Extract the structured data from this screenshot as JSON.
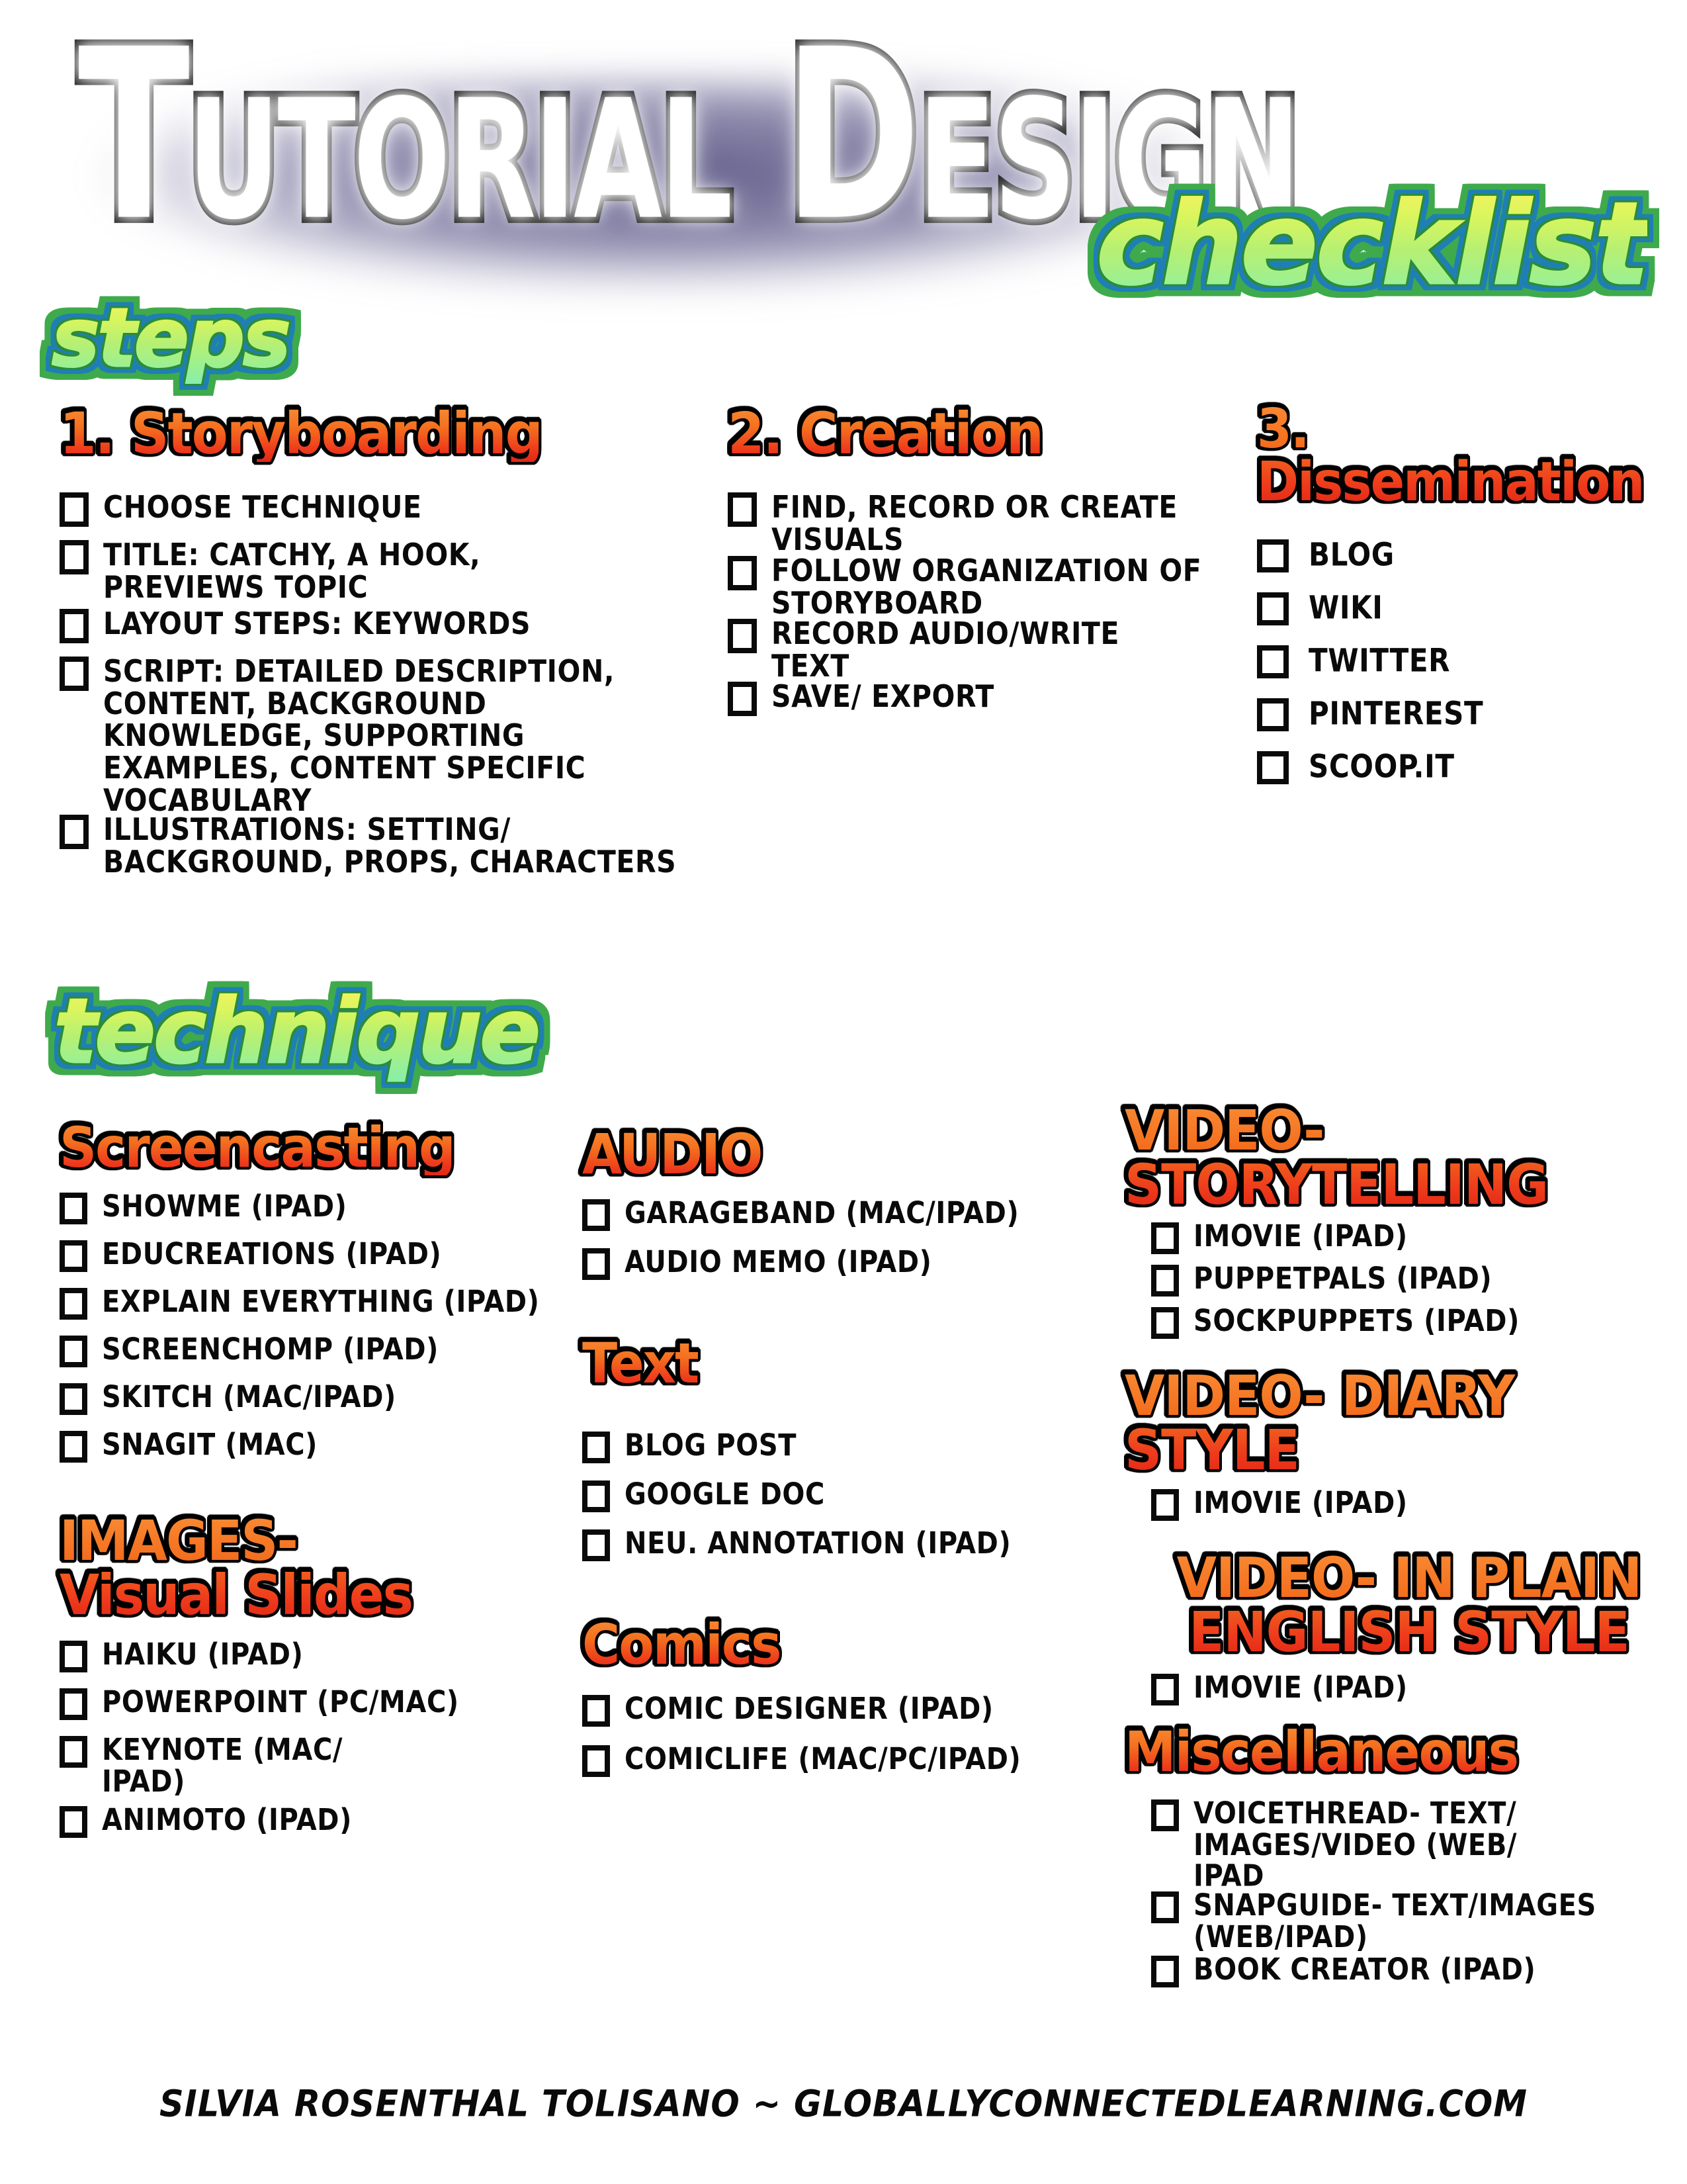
{
  "title": {
    "main": "Tutorial Design",
    "accent": "checklist"
  },
  "banners": {
    "steps": "steps",
    "technique": "technique"
  },
  "colors": {
    "heading_orange_top": "#f98a33",
    "heading_orange_bottom": "#e02714",
    "banner_yellow": "#fdf35e",
    "banner_green": "#85efad",
    "banner_outline_green": "#2a8b3a",
    "banner_outline_blue": "#1f7fb5",
    "title_shadow_purple": "#585482",
    "ink": "#0a0a0a",
    "page_bg": "#ffffff"
  },
  "steps": [
    {
      "heading": "1. Storyboarding",
      "items": [
        "CHOOSE TECHNIQUE",
        "TITLE: CATCHY, A HOOK,\nPREVIEWS TOPIC",
        "LAYOUT STEPS: KEYWORDS",
        "SCRIPT: DETAILED DESCRIPTION,\nCONTENT, BACKGROUND\nKNOWLEDGE, SUPPORTING\nEXAMPLES, CONTENT SPECIFIC\nVOCABULARY",
        "ILLUSTRATIONS: SETTING/\nBACKGROUND, PROPS, CHARACTERS"
      ]
    },
    {
      "heading": "2. Creation",
      "items": [
        "FIND, RECORD OR CREATE\nVISUALS",
        "FOLLOW ORGANIZATION OF\nSTORYBOARD",
        "RECORD AUDIO/WRITE\nTEXT",
        " SAVE/ EXPORT"
      ]
    },
    {
      "heading": "3. Dissemination",
      "items": [
        "BLOG",
        "WIKI",
        "TWITTER",
        "PINTEREST",
        "SCOOP.IT"
      ]
    }
  ],
  "technique": {
    "column1": [
      {
        "heading": "Screencasting",
        "items": [
          "SHOWME (IPAD)",
          "EDUCREATIONS (IPAD)",
          "EXPLAIN EVERYTHING (IPAD)",
          "SCREENCHOMP (IPAD)",
          "SKITCH (MAC/IPAD)",
          "SNAGIT (MAC)"
        ]
      },
      {
        "heading": "IMAGES-\nVisual Slides",
        "items": [
          "HAIKU (IPAD)",
          "POWERPOINT (PC/MAC)",
          "KEYNOTE (MAC/\nIPAD)",
          "ANIMOTO (IPAD)"
        ]
      }
    ],
    "column2": [
      {
        "heading": "AUDIO",
        "items": [
          "GARAGEBAND (MAC/IPAD)",
          "AUDIO MEMO (IPAD)"
        ]
      },
      {
        "heading": "Text",
        "items": [
          "BLOG POST",
          "GOOGLE DOC",
          "NEU. ANNOTATION (IPAD)"
        ]
      },
      {
        "heading": "Comics",
        "items": [
          "COMIC DESIGNER (IPAD)",
          "COMICLIFE (MAC/PC/IPAD)"
        ]
      }
    ],
    "column3": [
      {
        "heading": "VIDEO- STORYTELLING",
        "items": [
          "IMOVIE (IPAD)",
          "PUPPETPALS (IPAD)",
          "SOCKPUPPETS (IPAD)"
        ]
      },
      {
        "heading": "VIDEO- DIARY STYLE",
        "items": [
          "IMOVIE (IPAD)"
        ]
      },
      {
        "heading": "VIDEO- IN PLAIN\nENGLISH STYLE",
        "items": [
          "IMOVIE (IPAD)"
        ]
      },
      {
        "heading": "Miscellaneous",
        "items": [
          "VOICETHREAD- TEXT/\nIMAGES/VIDEO (WEB/\nIPAD",
          "SNAPGUIDE- TEXT/IMAGES\n(WEB/IPAD)",
          "BOOK CREATOR (IPAD)"
        ]
      }
    ]
  },
  "footer": {
    "credit": "SILVIA ROSENTHAL TOLISANO ~ GLOBALLYCONNECTEDLEARNING.COM"
  }
}
